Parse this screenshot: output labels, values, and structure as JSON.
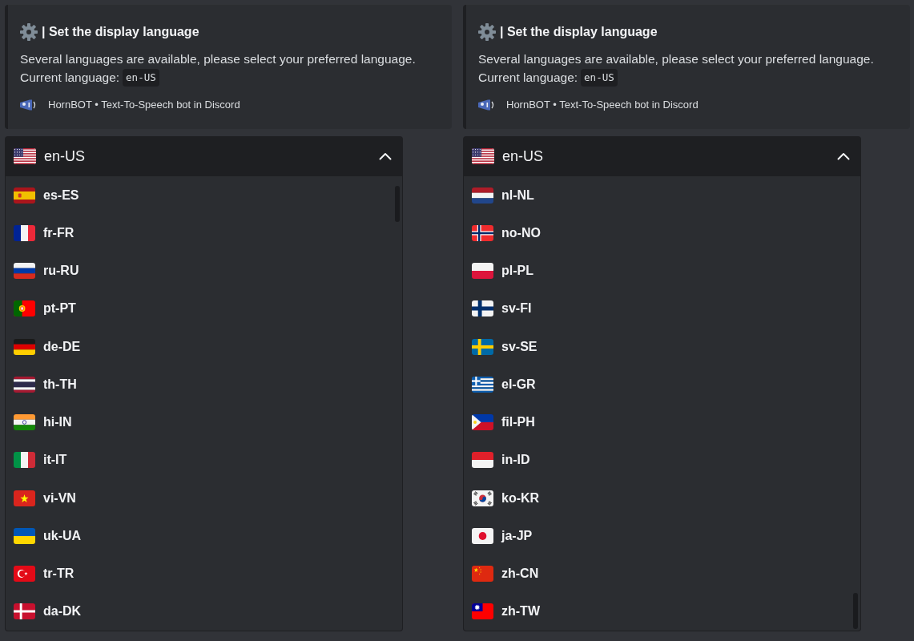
{
  "panels": [
    {
      "card": {
        "title": "| Set the display language",
        "description": "Several languages are available, please select your preferred language.",
        "current_label": "Current language:",
        "current_value": "en-US",
        "footer": "HornBOT • Text-To-Speech bot in Discord"
      },
      "dropdown": {
        "selection": {
          "label": "en-US",
          "kind": "usa"
        },
        "expanded": true,
        "options": [
          {
            "label": "es-ES",
            "kind": "spain",
            "selected": false
          },
          {
            "label": "fr-FR",
            "kind": "france",
            "selected": false
          },
          {
            "label": "ru-RU",
            "kind": "russia",
            "selected": false
          },
          {
            "label": "pt-PT",
            "kind": "portugal",
            "selected": false
          },
          {
            "label": "de-DE",
            "kind": "germany",
            "selected": false
          },
          {
            "label": "th-TH",
            "kind": "thailand",
            "selected": false
          },
          {
            "label": "hi-IN",
            "kind": "india",
            "selected": false
          },
          {
            "label": "it-IT",
            "kind": "italy",
            "selected": false
          },
          {
            "label": "vi-VN",
            "kind": "vietnam",
            "selected": false
          },
          {
            "label": "uk-UA",
            "kind": "ukraine",
            "selected": false
          },
          {
            "label": "tr-TR",
            "kind": "turkey",
            "selected": false
          },
          {
            "label": "da-DK",
            "kind": "denmark",
            "selected": false
          }
        ]
      }
    },
    {
      "card": {
        "title": "| Set the display language",
        "description": "Several languages are available, please select your preferred language.",
        "current_label": "Current language:",
        "current_value": "en-US",
        "footer": "HornBOT • Text-To-Speech bot in Discord"
      },
      "dropdown": {
        "selection": {
          "label": "en-US",
          "kind": "usa"
        },
        "expanded": true,
        "options": [
          {
            "label": "nl-NL",
            "kind": "netherlands",
            "selected": false
          },
          {
            "label": "no-NO",
            "kind": "norway",
            "selected": false
          },
          {
            "label": "pl-PL",
            "kind": "poland",
            "selected": false
          },
          {
            "label": "sv-FI",
            "kind": "finland",
            "selected": false
          },
          {
            "label": "sv-SE",
            "kind": "sweden",
            "selected": false
          },
          {
            "label": "el-GR",
            "kind": "greece",
            "selected": false
          },
          {
            "label": "fil-PH",
            "kind": "philippines",
            "selected": false
          },
          {
            "label": "in-ID",
            "kind": "indonesia",
            "selected": false
          },
          {
            "label": "ko-KR",
            "kind": "korea",
            "selected": false
          },
          {
            "label": "ja-JP",
            "kind": "japan",
            "selected": false
          },
          {
            "label": "zh-CN",
            "kind": "china",
            "selected": false
          },
          {
            "label": "zh-TW",
            "kind": "taiwan",
            "selected": false
          }
        ]
      }
    }
  ]
}
